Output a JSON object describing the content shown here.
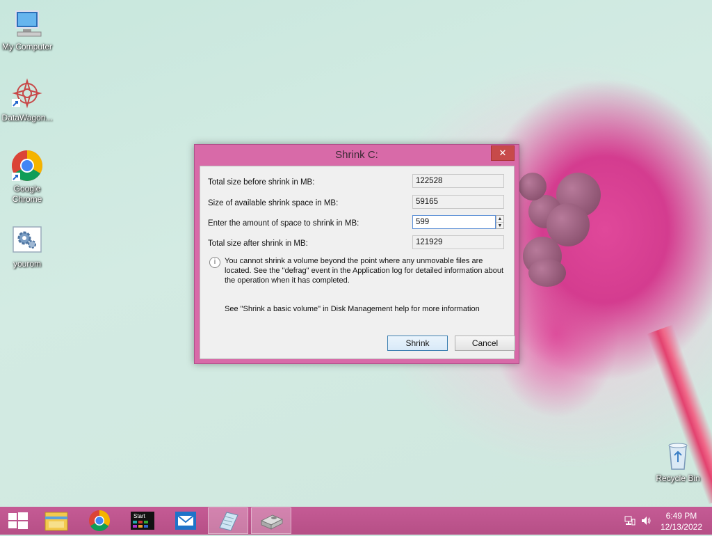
{
  "desktop": {
    "icons": [
      {
        "label": "My Computer",
        "icon": "computer-icon"
      },
      {
        "label": "DataWagon...",
        "icon": "datawagon-icon"
      },
      {
        "label": "Google Chrome",
        "icon": "chrome-icon"
      },
      {
        "label": "yourom",
        "icon": "settings-gear-icon"
      },
      {
        "label": "Recycle Bin",
        "icon": "recycle-bin-icon"
      }
    ]
  },
  "dialog": {
    "title": "Shrink C:",
    "close_glyph": "✕",
    "rows": [
      {
        "label": "Total size before shrink in MB:",
        "value": "122528"
      },
      {
        "label": "Size of available shrink space in MB:",
        "value": "59165"
      },
      {
        "label": "Enter the amount of space to shrink in MB:",
        "value": "599"
      },
      {
        "label": "Total size after shrink in MB:",
        "value": "121929"
      }
    ],
    "info_text": "You cannot shrink a volume beyond the point where any unmovable files are located. See the \"defrag\" event in the Application log for detailed information about the operation when it has completed.",
    "help_text": "See \"Shrink a basic volume\" in Disk Management help for more information",
    "buttons": {
      "shrink": "Shrink",
      "cancel": "Cancel"
    }
  },
  "taskbar": {
    "items": [
      "start-icon",
      "file-explorer-icon",
      "chrome-icon",
      "start-tile-icon",
      "mail-icon",
      "notepad-icon",
      "disk-management-icon"
    ],
    "start_tile_label": "Start",
    "clock": {
      "time": "6:49 PM",
      "date": "12/13/2022"
    }
  }
}
